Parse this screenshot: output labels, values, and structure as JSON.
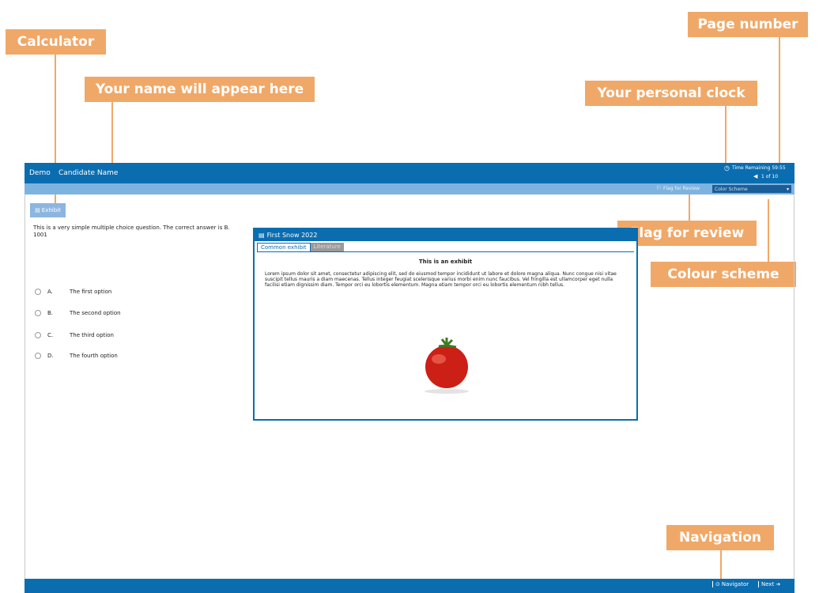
{
  "callouts": {
    "calculator": "Calculator",
    "name": "Your name will appear here",
    "page_number": "Page number",
    "personal_clock": "Your personal clock",
    "flag_review": "Flag for review",
    "colour_scheme": "Colour scheme",
    "navigation": "Navigation"
  },
  "header": {
    "demo": "Demo",
    "candidate": "Candidate Name",
    "time_label": "Time Remaining 59:55",
    "page": "1 of 10"
  },
  "toolbar": {
    "flag_label": "Flag for Review",
    "color_scheme": "Color Scheme",
    "exhibit_label": "Exhibit"
  },
  "question": {
    "text": "This is a very simple multiple choice question. The correct answer is B.",
    "id": "1001",
    "options": [
      {
        "letter": "A.",
        "text": "The first option"
      },
      {
        "letter": "B.",
        "text": "The second option"
      },
      {
        "letter": "C.",
        "text": "The third option"
      },
      {
        "letter": "D.",
        "text": "The fourth option"
      }
    ]
  },
  "exhibit_window": {
    "title": "First Snow 2022",
    "tabs": [
      "Common exhibit",
      "Literature"
    ],
    "heading": "This is an exhibit",
    "body": "Lorem ipsum dolor sit amet, consectetur adipiscing elit, sed do eiusmod tempor incididunt ut labore et dolore magna aliqua. Nunc congue nisi vitae suscipit tellus mauris a diam maecenas. Tellus integer feugiat scelerisque varius morbi enim nunc faucibus. Vel fringilla est ullamcorper eget nulla facilisi etiam dignissim diam. Tempor orci eu lobortis elementum. Magna etiam tempor orci eu lobortis elementum nibh tellus."
  },
  "footer": {
    "navigator": "Navigator",
    "next": "Next"
  },
  "colors": {
    "callout": "#f0a868",
    "header": "#0a6db0",
    "subbar": "#7fb3df"
  }
}
